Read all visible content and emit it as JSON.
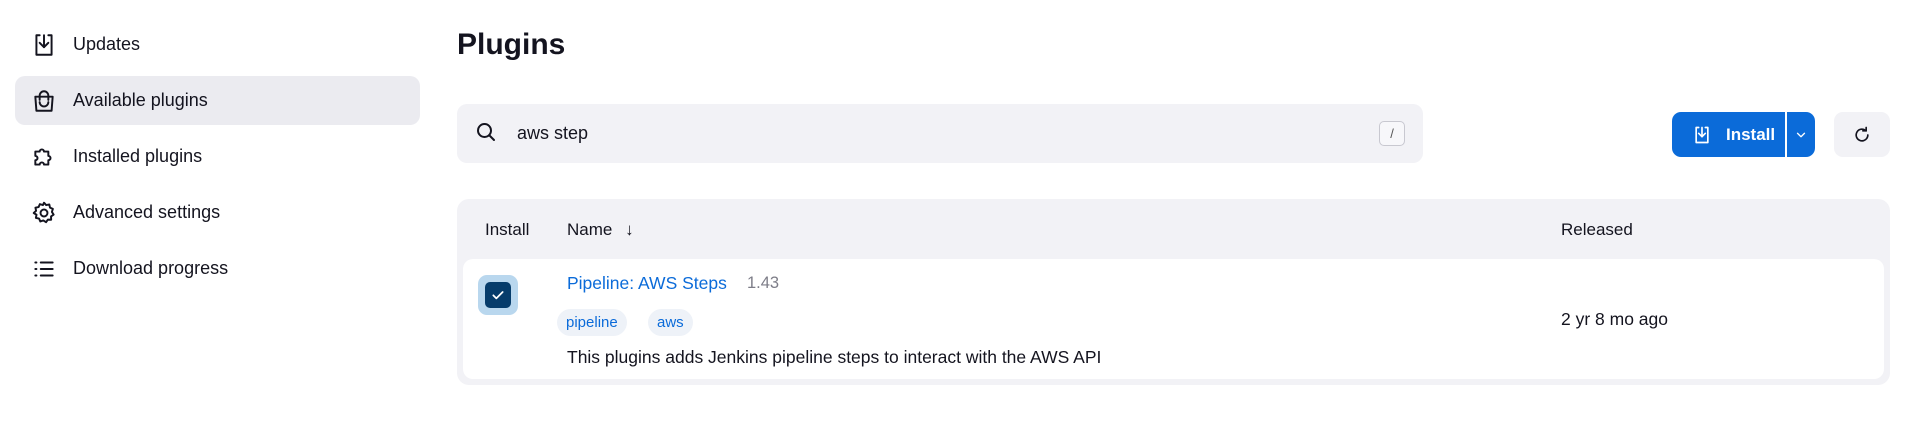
{
  "sidebar": {
    "items": [
      {
        "label": "Updates",
        "icon": "download-icon",
        "active": false
      },
      {
        "label": "Available plugins",
        "icon": "shopping-bag-icon",
        "active": true
      },
      {
        "label": "Installed plugins",
        "icon": "puzzle-icon",
        "active": false
      },
      {
        "label": "Advanced settings",
        "icon": "gear-icon",
        "active": false
      },
      {
        "label": "Download progress",
        "icon": "list-icon",
        "active": false
      }
    ]
  },
  "page": {
    "title": "Plugins"
  },
  "search": {
    "value": "aws step",
    "shortcut": "/"
  },
  "toolbar": {
    "install_label": "Install",
    "accent_color": "#0b6bd9"
  },
  "table": {
    "headers": {
      "install": "Install",
      "name": "Name",
      "sort_indicator": "↓",
      "released": "Released"
    },
    "rows": [
      {
        "checked": true,
        "name": "Pipeline: AWS Steps",
        "version": "1.43",
        "tags": [
          "pipeline",
          "aws"
        ],
        "description": "This plugins adds Jenkins pipeline steps to interact with the AWS API",
        "released": "2 yr 8 mo ago"
      }
    ]
  }
}
